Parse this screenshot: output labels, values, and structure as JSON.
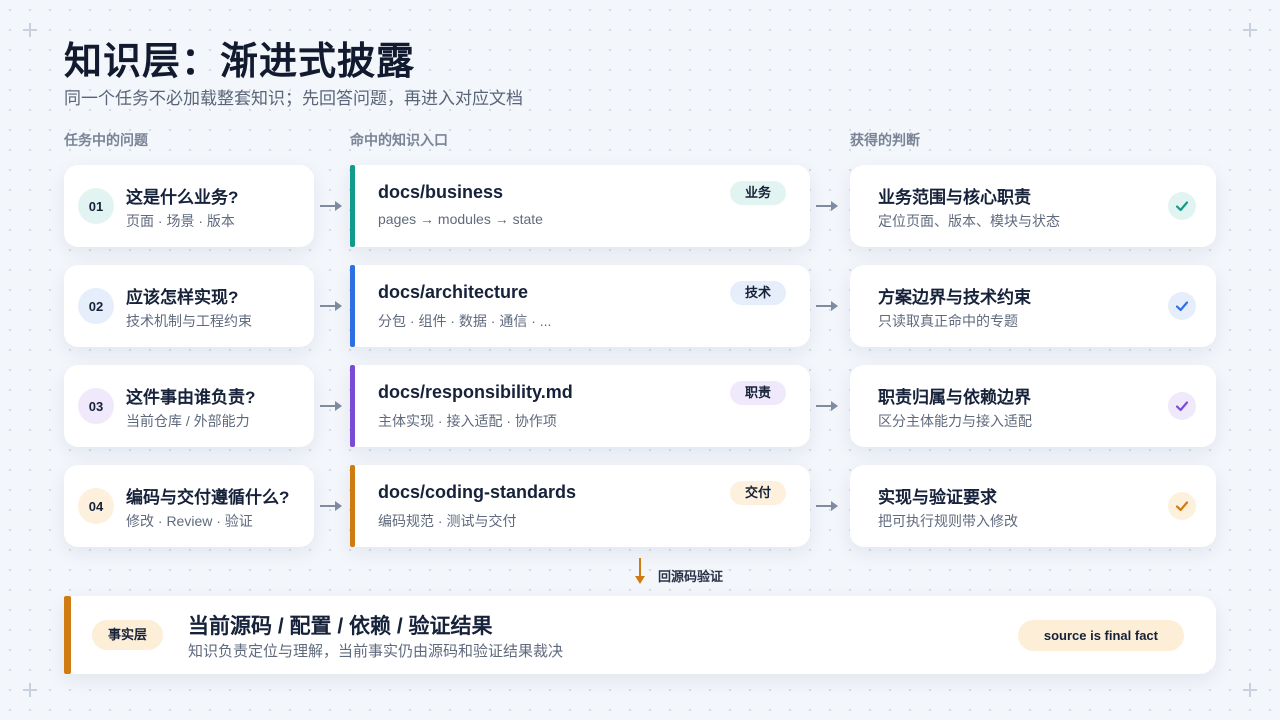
{
  "header": {
    "title": "知识层：渐进式披露",
    "subtitle": "同一个任务不必加载整套知识；先回答问题，再进入对应文档"
  },
  "columns": {
    "questions": "任务中的问题",
    "docs": "命中的知识入口",
    "results": "获得的判断"
  },
  "rows": [
    {
      "num": "01",
      "question": "这是什么业务?",
      "question_sub": "页面 · 场景 · 版本",
      "doc": "docs/business",
      "doc_sub": "pages → modules → state",
      "tag": "业务",
      "result": "业务范围与核心职责",
      "result_sub": "定位页面、版本、模块与状态",
      "accent": "#129a8b",
      "accent_light": "#e2f4f1",
      "icon": "check-icon"
    },
    {
      "num": "02",
      "question": "应该怎样实现?",
      "question_sub": "技术机制与工程约束",
      "doc": "docs/architecture",
      "doc_sub": "分包 · 组件 · 数据 · 通信 · ...",
      "tag": "技术",
      "result": "方案边界与技术约束",
      "result_sub": "只读取真正命中的专题",
      "accent": "#2f6fe4",
      "accent_light": "#e6eefb",
      "icon": "check-icon"
    },
    {
      "num": "03",
      "question": "这件事由谁负责?",
      "question_sub": "当前仓库 / 外部能力",
      "doc": "docs/responsibility.md",
      "doc_sub": "主体实现 · 接入适配 · 协作项",
      "tag": "职责",
      "result": "职责归属与依赖边界",
      "result_sub": "区分主体能力与接入适配",
      "accent": "#7a4bd6",
      "accent_light": "#efe9fb",
      "icon": "check-icon"
    },
    {
      "num": "04",
      "question": "编码与交付遵循什么?",
      "question_sub": "修改 · Review · 验证",
      "doc": "docs/coding-standards",
      "doc_sub": "编码规范 · 测试与交付",
      "tag": "交付",
      "result": "实现与验证要求",
      "result_sub": "把可执行规则带入修改",
      "accent": "#d07a12",
      "accent_light": "#fdf0dc",
      "icon": "check-icon"
    }
  ],
  "verify_label": "回源码验证",
  "fact": {
    "badge": "事实层",
    "title": "当前源码 / 配置 / 依赖 / 验证结果",
    "subtitle": "知识负责定位与理解，当前事实仍由源码和验证结果裁决",
    "pill": "source is final fact",
    "accent": "#d07a12"
  }
}
